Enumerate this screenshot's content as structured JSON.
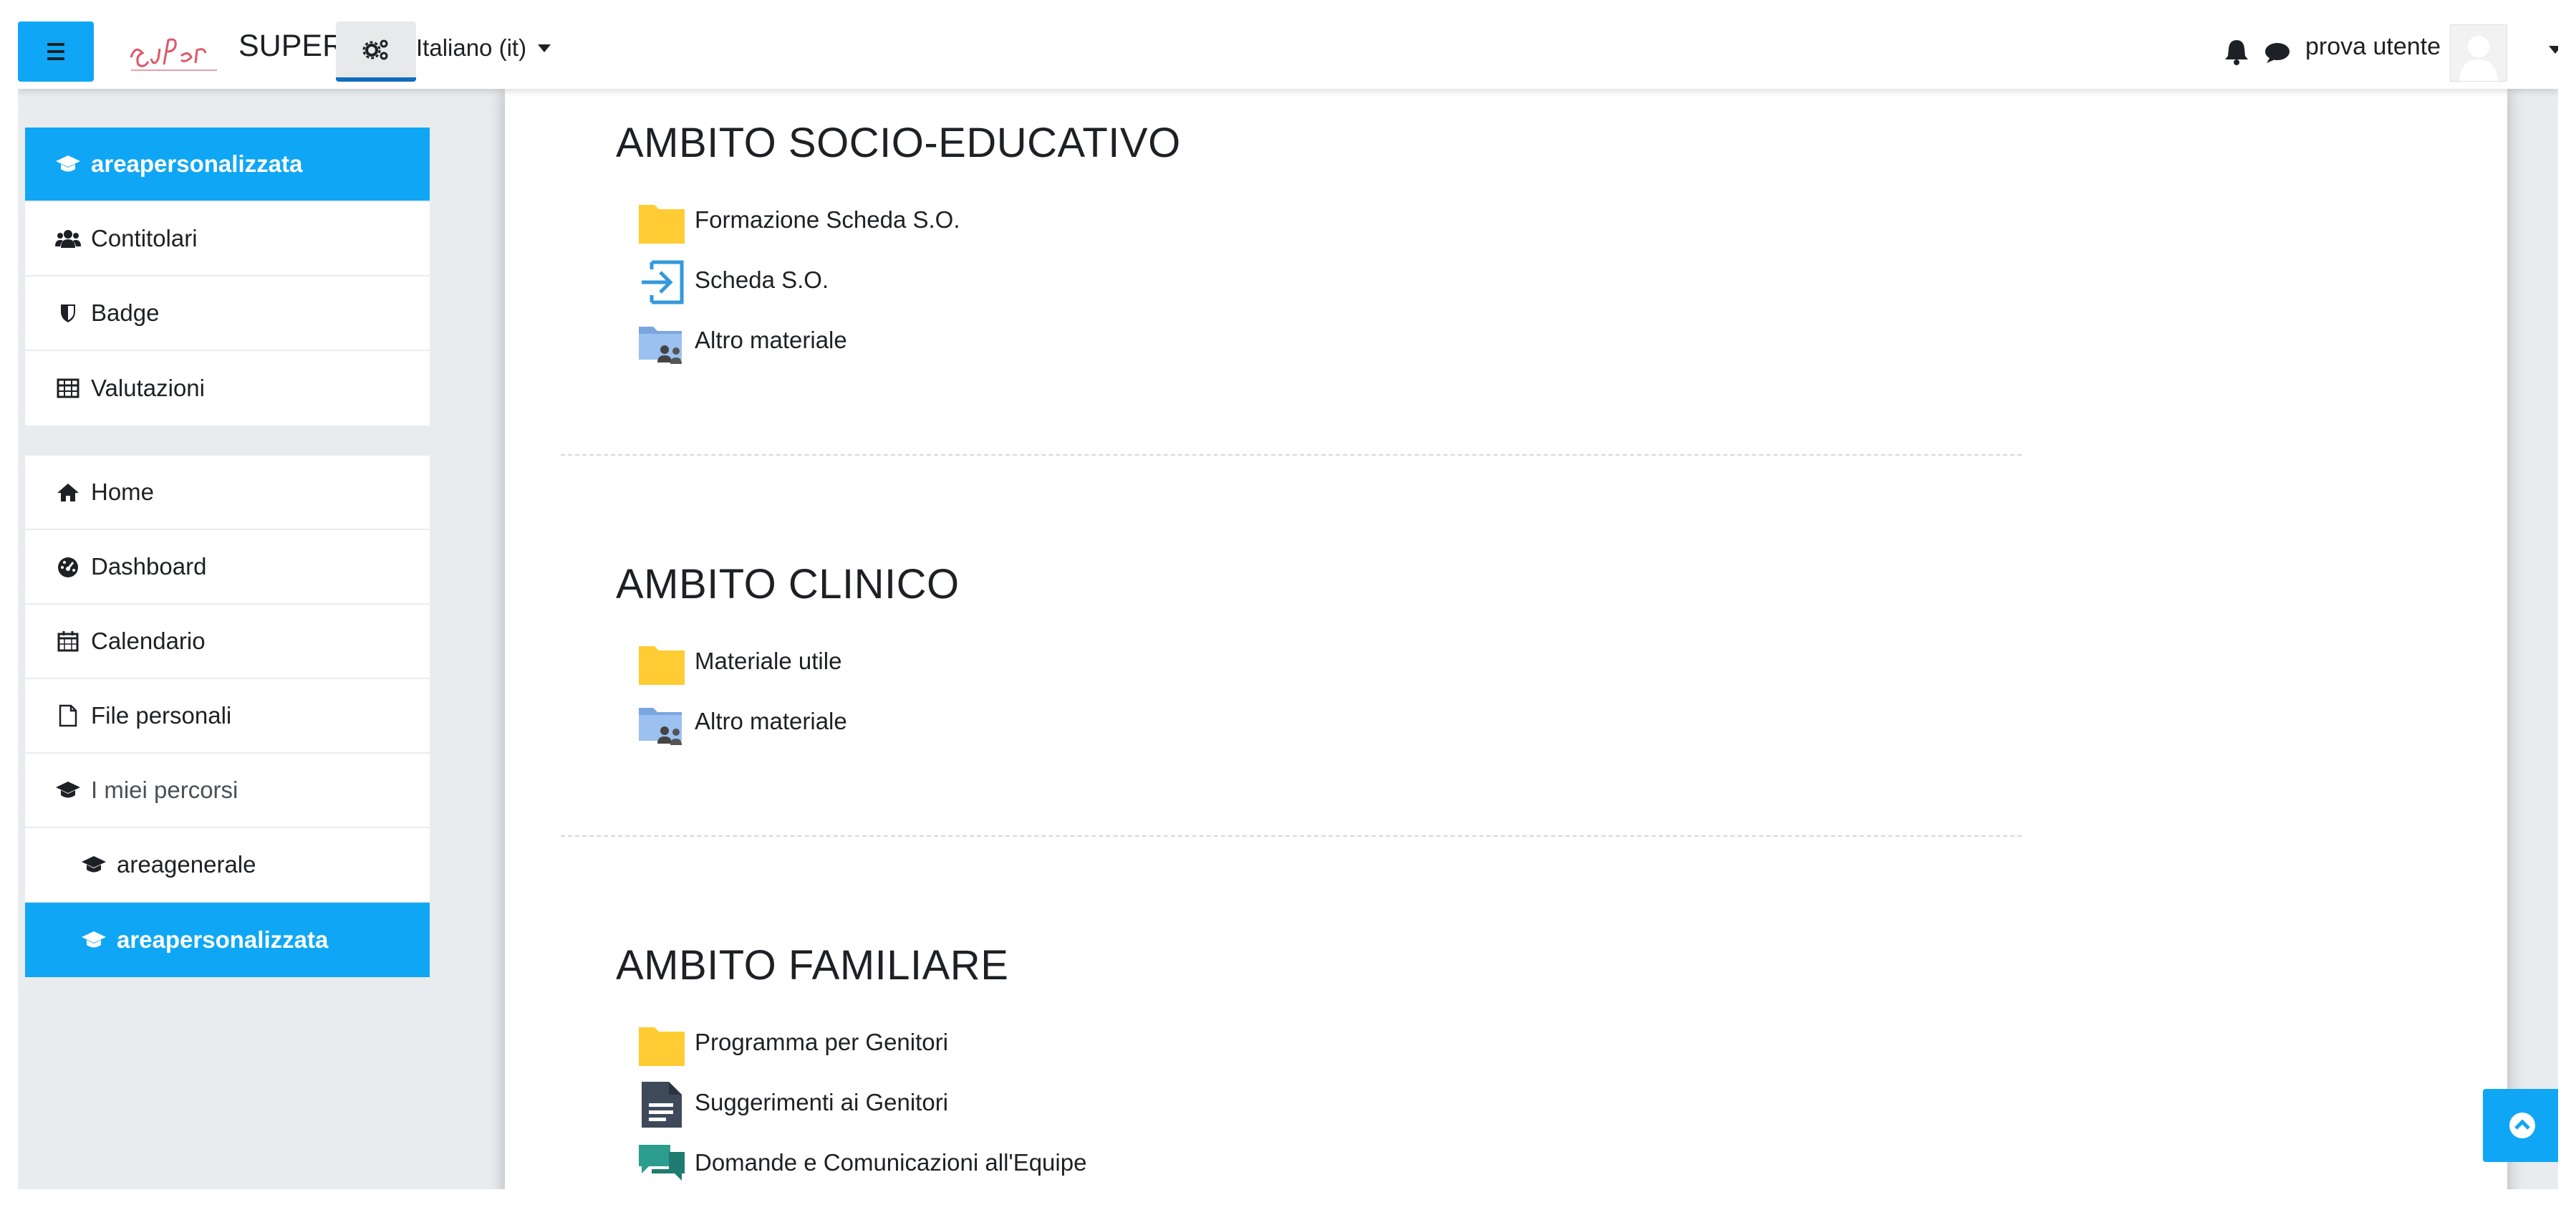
{
  "navbar": {
    "site_name": "SUPER",
    "language": "Italiano (it)",
    "user_name": "prova utente"
  },
  "sidebar": {
    "course_group": [
      {
        "label": "areapersonalizzata",
        "icon": "graduation-cap-icon",
        "active": true
      },
      {
        "label": "Contitolari",
        "icon": "users-icon"
      },
      {
        "label": "Badge",
        "icon": "shield-icon"
      },
      {
        "label": "Valutazioni",
        "icon": "table-icon"
      }
    ],
    "nav_group": [
      {
        "label": "Home",
        "icon": "home-icon"
      },
      {
        "label": "Dashboard",
        "icon": "dashboard-icon"
      },
      {
        "label": "Calendario",
        "icon": "calendar-icon"
      },
      {
        "label": "File personali",
        "icon": "file-icon"
      },
      {
        "label": "I miei percorsi",
        "icon": "graduation-cap-icon"
      },
      {
        "label": "areagenerale",
        "icon": "graduation-cap-icon"
      },
      {
        "label": "areapersonalizzata",
        "icon": "graduation-cap-icon",
        "active": true
      }
    ]
  },
  "sections": [
    {
      "title": "AMBITO SOCIO-EDUCATIVO",
      "activities": [
        {
          "label": "Formazione Scheda S.O.",
          "icon": "folder-icon"
        },
        {
          "label": "Scheda S.O.",
          "icon": "url-icon"
        },
        {
          "label": "Altro materiale",
          "icon": "shared-folder-icon"
        }
      ]
    },
    {
      "title": "AMBITO CLINICO",
      "activities": [
        {
          "label": "Materiale utile",
          "icon": "folder-icon"
        },
        {
          "label": "Altro materiale",
          "icon": "shared-folder-icon"
        }
      ]
    },
    {
      "title": "AMBITO FAMILIARE",
      "activities": [
        {
          "label": "Programma per Genitori",
          "icon": "folder-icon"
        },
        {
          "label": "Suggerimenti ai Genitori",
          "icon": "page-icon"
        },
        {
          "label": "Domande e Comunicazioni all'Equipe",
          "icon": "forum-icon"
        }
      ]
    }
  ],
  "colors": {
    "accent": "#0fa7f5",
    "folder": "#ffcc33",
    "page_bg": "#e9ecef"
  }
}
